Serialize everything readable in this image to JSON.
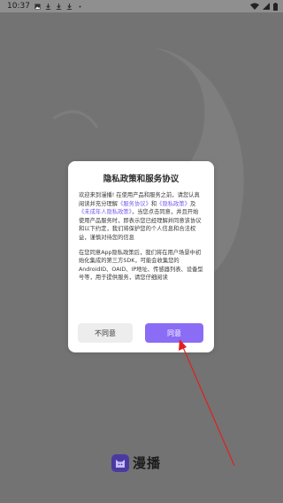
{
  "status_bar": {
    "time": "10:37",
    "icons": [
      "image-icon",
      "download-icon",
      "download-icon",
      "download-icon",
      "dot-icon"
    ],
    "right_icons": [
      "wifi-icon",
      "signal-icon",
      "battery-icon"
    ]
  },
  "dialog": {
    "title": "隐私政策和服务协议",
    "paragraph1": {
      "t1": "欢迎来到漫播! 在使用产品和服务之前，请您认真阅读并充分理解",
      "link1": "《服务协议》",
      "t2": "和",
      "link2": "《隐私政策》",
      "t3": "及",
      "link3": "《未成年人隐私政策》",
      "t4": "，当您点击同意，并且开始使用产品服务时，即表示您已经理解并同意该协议和以下约定，我们将保护您的个人信息和合法权益，谨慎对待您的信息"
    },
    "paragraph2": "在您同意App隐私政策后，我们将在用户场景中初始化集成的第三方SDK，可能会收集您的AndroidID、OAID、IP地址、传感器列表、设备型号等，用于提供服务，请您仔细阅读",
    "disagree_label": "不同意",
    "agree_label": "同意",
    "accent_color": "#8a6cf5"
  },
  "brand": {
    "logo_icon": "cat-logo-icon",
    "name": "漫播"
  }
}
